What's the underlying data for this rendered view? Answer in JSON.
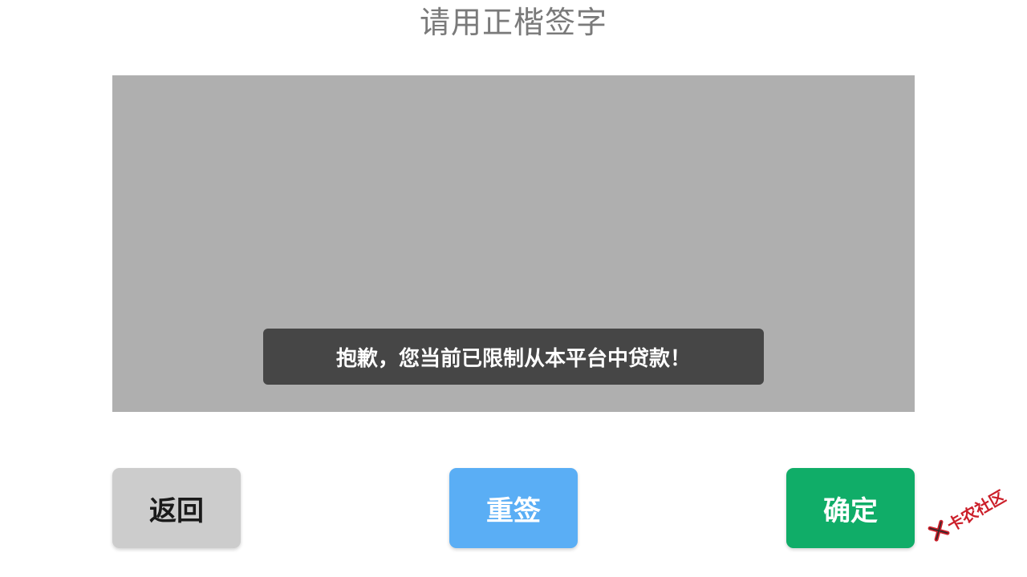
{
  "header": {
    "title": "请用正楷签字"
  },
  "toast": {
    "message": "抱歉，您当前已限制从本平台中贷款！"
  },
  "buttons": {
    "back_label": "返回",
    "reset_label": "重签",
    "confirm_label": "确定"
  },
  "watermark": {
    "text": "卡农社区"
  },
  "colors": {
    "pad": "#afafaf",
    "toast_bg": "#464646",
    "back_bg": "#cccccc",
    "reset_bg": "#5aaef5",
    "confirm_bg": "#10ad68",
    "watermark": "#cc1f2a"
  }
}
